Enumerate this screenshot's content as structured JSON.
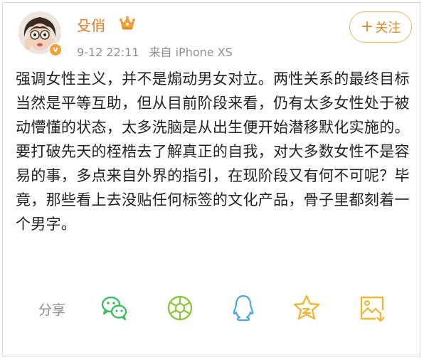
{
  "post": {
    "username": "殳俏",
    "timestamp": "9-12 22:11",
    "source": "来自 iPhone XS",
    "follow_label": "关注",
    "follow_plus": "+",
    "content": "强调女性主义，并不是煽动男女对立。两性关系的最终目标当然是平等互助，但从目前阶段来看，仍有太多女性处于被动懵懂的状态，太多洗脑是从出生便开始潜移默化实施的。要打破先天的桎梏去了解真正的自我，对大多数女性不是容易的事，多点来自外界的指引，在现阶段又有何不可呢？毕竟，那些看上去没贴任何标签的文化产品，骨子里都刻着一个男字。"
  },
  "share": {
    "label": "分享",
    "targets": [
      {
        "icon": "wechat-icon",
        "color": "#3ebf5f"
      },
      {
        "icon": "wechat-moments-icon",
        "color": "#8cc63f"
      },
      {
        "icon": "qq-icon",
        "color": "#4aa8e0"
      },
      {
        "icon": "qzone-star-icon",
        "color": "#f2b632"
      },
      {
        "icon": "save-image-icon",
        "color": "#f2b632"
      }
    ]
  }
}
